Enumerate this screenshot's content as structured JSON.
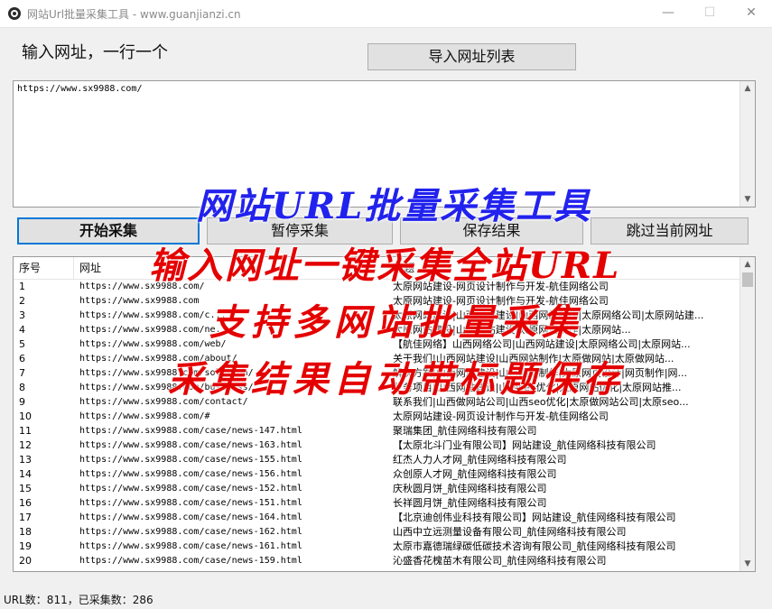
{
  "window": {
    "title": "网站Url批量采集工具 - www.guanjianzi.cn",
    "minimize_glyph": "—",
    "maximize_glyph": "☐",
    "close_glyph": "✕"
  },
  "instruction": "输入网址，一行一个",
  "import_button": "导入网址列表",
  "url_input_value": "https://www.sx9988.com/",
  "actions": {
    "start": "开始采集",
    "pause": "暂停采集",
    "save": "保存结果",
    "skip": "跳过当前网址"
  },
  "table": {
    "headers": [
      "序号",
      "网址",
      "标题"
    ],
    "rows": [
      {
        "idx": "1",
        "url": "https://www.sx9988.com/",
        "title": "太原网站建设-网页设计制作与开发-航佳网络公司"
      },
      {
        "idx": "2",
        "url": "https://www.sx9988.com",
        "title": "太原网站建设-网页设计制作与开发-航佳网络公司"
      },
      {
        "idx": "3",
        "url": "https://www.sx9988.com/c...",
        "title": "太原网站建设|山西网站建设|山西网站制作|太原网络公司|太原网站建..."
      },
      {
        "idx": "4",
        "url": "https://www.sx9988.com/ne...",
        "title": "太原网站建设|山西网站建设|太原网站制作|太原网站..."
      },
      {
        "idx": "5",
        "url": "https://www.sx9988.com/web/",
        "title": "【航佳网络】山西网络公司|山西网站建设|太原网络公司|太原网站..."
      },
      {
        "idx": "6",
        "url": "https://www.sx9988.com/about/",
        "title": "关于我们|山西网站建设|山西网站制作|太原做网站|太原做网站..."
      },
      {
        "idx": "7",
        "url": "https://www.sx9988.com/solution/",
        "title": "解决方案|山西网站建设|山西网站制作|太原网页设计|网页制作|网..."
      },
      {
        "idx": "8",
        "url": "https://www.sx9988.com/business/",
        "title": "业务项目|山西网站建设|山西seo优化|太原网站优化|太原网站推..."
      },
      {
        "idx": "9",
        "url": "https://www.sx9988.com/contact/",
        "title": "联系我们|山西做网站公司|山西seo优化|太原做网站公司|太原seo..."
      },
      {
        "idx": "10",
        "url": "https://www.sx9988.com/#",
        "title": "太原网站建设-网页设计制作与开发-航佳网络公司"
      },
      {
        "idx": "11",
        "url": "https://www.sx9988.com/case/news-147.html",
        "title": "聚瑞集团_航佳网络科技有限公司"
      },
      {
        "idx": "12",
        "url": "https://www.sx9988.com/case/news-163.html",
        "title": "【太原北斗门业有限公司】网站建设_航佳网络科技有限公司"
      },
      {
        "idx": "13",
        "url": "https://www.sx9988.com/case/news-155.html",
        "title": "红杰人力人才网_航佳网络科技有限公司"
      },
      {
        "idx": "14",
        "url": "https://www.sx9988.com/case/news-156.html",
        "title": "众创原人才网_航佳网络科技有限公司"
      },
      {
        "idx": "15",
        "url": "https://www.sx9988.com/case/news-152.html",
        "title": "庆秋圆月饼_航佳网络科技有限公司"
      },
      {
        "idx": "16",
        "url": "https://www.sx9988.com/case/news-151.html",
        "title": "长祥圆月饼_航佳网络科技有限公司"
      },
      {
        "idx": "17",
        "url": "https://www.sx9988.com/case/news-164.html",
        "title": "【北京迪创伟业科技有限公司】网站建设_航佳网络科技有限公司"
      },
      {
        "idx": "18",
        "url": "https://www.sx9988.com/case/news-162.html",
        "title": "山西中立远测量设备有限公司_航佳网络科技有限公司"
      },
      {
        "idx": "19",
        "url": "https://www.sx9988.com/case/news-161.html",
        "title": "太原市嘉德瑞绿碳低碳技术咨询有限公司_航佳网络科技有限公司"
      },
      {
        "idx": "20",
        "url": "https://www.sx9988.com/case/news-159.html",
        "title": "沁盛香花槐苗木有限公司_航佳网络科技有限公司"
      }
    ]
  },
  "status_text": "URL数：811，已采集数：286",
  "overlays": {
    "line1": "网站URL批量采集工具",
    "line2": "输入网址一键采集全站URL",
    "line3": "支持多网站批量采集",
    "line4": "采集结果自动带标题保存"
  },
  "colors": {
    "overlay_blue": "#2222ee",
    "overlay_red": "#e50000",
    "primary_border": "#0078d7"
  },
  "icons": {
    "app": "app-icon",
    "scroll_up": "chevron-up-icon",
    "scroll_down": "chevron-down-icon"
  }
}
